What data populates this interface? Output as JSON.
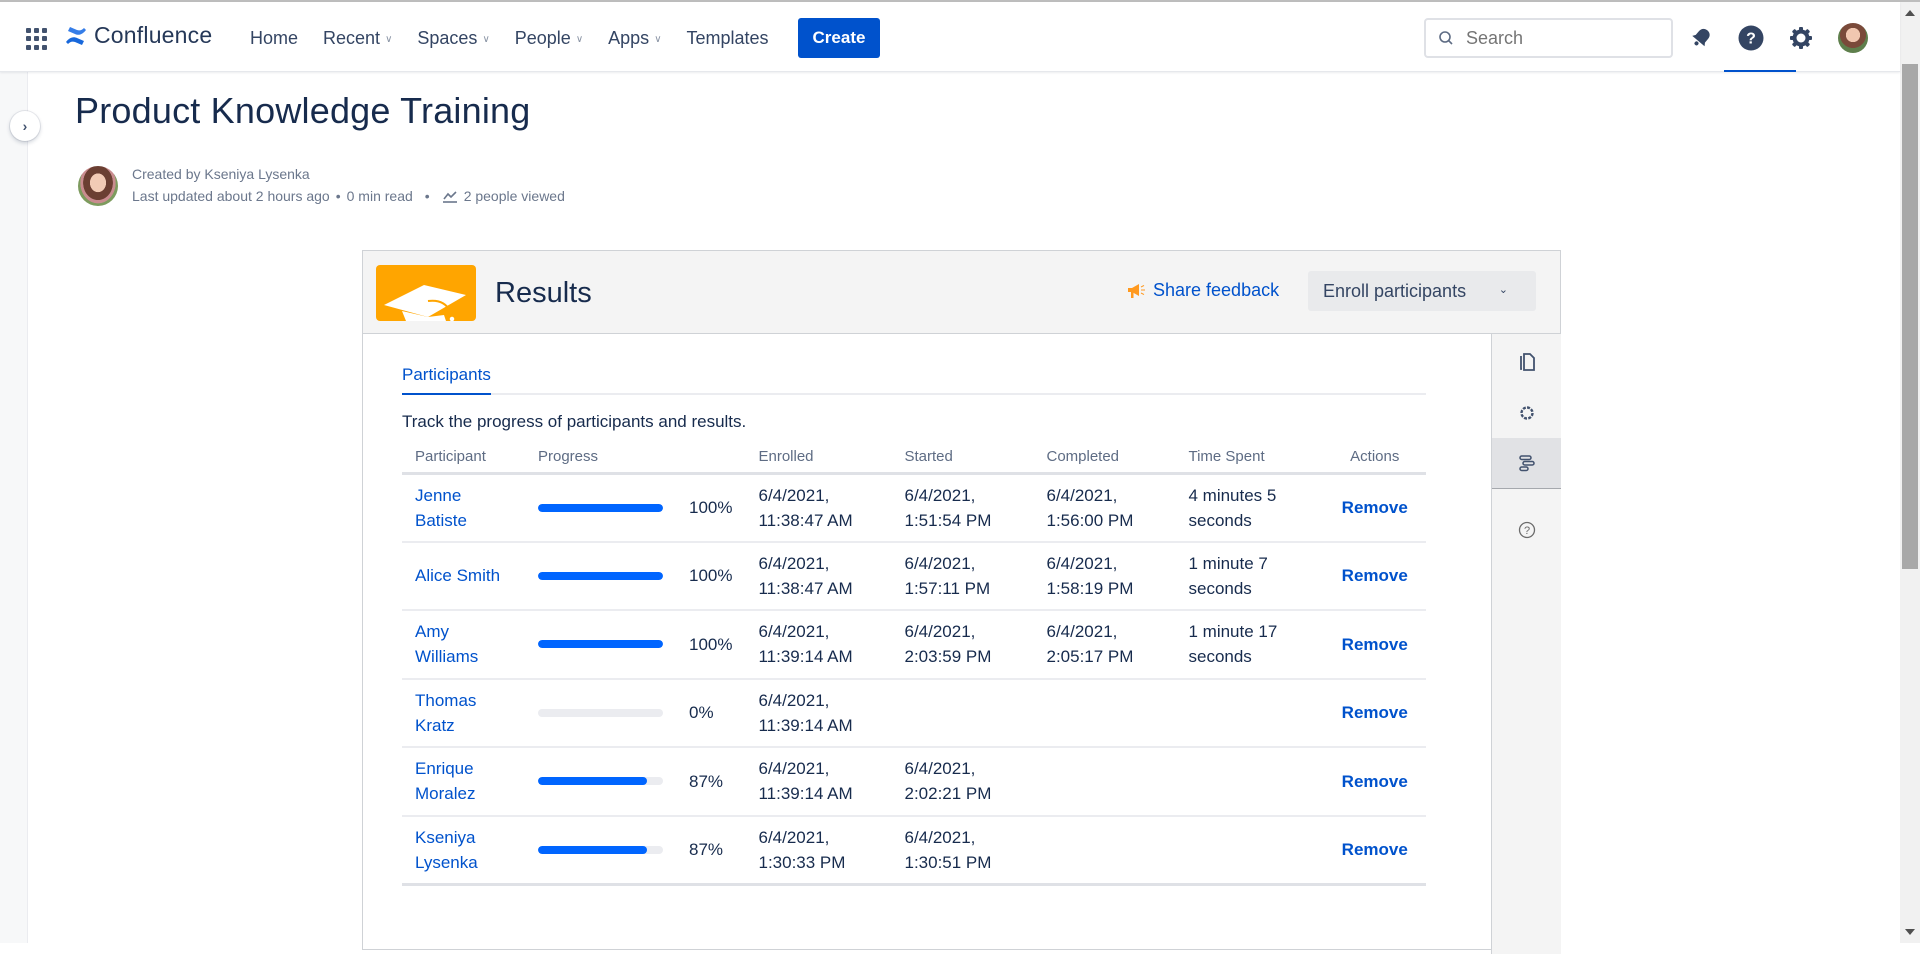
{
  "header": {
    "app_name": "Confluence",
    "nav": [
      {
        "label": "Home",
        "has_dropdown": false
      },
      {
        "label": "Recent",
        "has_dropdown": true
      },
      {
        "label": "Spaces",
        "has_dropdown": true
      },
      {
        "label": "People",
        "has_dropdown": true
      },
      {
        "label": "Apps",
        "has_dropdown": true
      },
      {
        "label": "Templates",
        "has_dropdown": false
      }
    ],
    "create_label": "Create",
    "search_placeholder": "Search",
    "icons": [
      "notifications-icon",
      "help-icon",
      "settings-icon",
      "profile-avatar"
    ],
    "brand_color": "#0052cc"
  },
  "page": {
    "title": "Product Knowledge Training",
    "created_by": "Created by Kseniya Lysenka",
    "last_updated": "Last updated about 2 hours ago",
    "read_time": "0 min read",
    "views": "2 people viewed"
  },
  "macro": {
    "title": "Results",
    "share_feedback": "Share feedback",
    "enroll_label": "Enroll participants",
    "tabs": [
      {
        "label": "Participants",
        "active": true
      }
    ],
    "description": "Track the progress of participants and results.",
    "tool_strip": [
      {
        "icon": "copy-icon",
        "active": false
      },
      {
        "icon": "settings-icon",
        "active": false
      },
      {
        "icon": "results-icon",
        "active": true
      },
      {
        "icon": "help-icon",
        "active": false
      }
    ],
    "table": {
      "columns": [
        "Participant",
        "Progress",
        "Enrolled",
        "Started",
        "Completed",
        "Time Spent",
        "Actions"
      ],
      "rows": [
        {
          "name": "Jenne Batiste",
          "progress": 100,
          "progress_label": "100%",
          "enrolled": "6/4/2021, 11:38:47 AM",
          "started": "6/4/2021, 1:51:54 PM",
          "completed": "6/4/2021, 1:56:00 PM",
          "time_spent": "4 minutes 5 seconds",
          "action": "Remove"
        },
        {
          "name": "Alice Smith",
          "progress": 100,
          "progress_label": "100%",
          "enrolled": "6/4/2021, 11:38:47 AM",
          "started": "6/4/2021, 1:57:11 PM",
          "completed": "6/4/2021, 1:58:19 PM",
          "time_spent": "1 minute 7 seconds",
          "action": "Remove"
        },
        {
          "name": "Amy Williams",
          "progress": 100,
          "progress_label": "100%",
          "enrolled": "6/4/2021, 11:39:14 AM",
          "started": "6/4/2021, 2:03:59 PM",
          "completed": "6/4/2021, 2:05:17 PM",
          "time_spent": "1 minute 17 seconds",
          "action": "Remove"
        },
        {
          "name": "Thomas Kratz",
          "progress": 0,
          "progress_label": "0%",
          "enrolled": "6/4/2021, 11:39:14 AM",
          "started": "",
          "completed": "",
          "time_spent": "",
          "action": "Remove"
        },
        {
          "name": "Enrique Moralez",
          "progress": 87,
          "progress_label": "87%",
          "enrolled": "6/4/2021, 11:39:14 AM",
          "started": "6/4/2021, 2:02:21 PM",
          "completed": "",
          "time_spent": "",
          "action": "Remove"
        },
        {
          "name": "Kseniya Lysenka",
          "progress": 87,
          "progress_label": "87%",
          "enrolled": "6/4/2021, 1:30:33 PM",
          "started": "6/4/2021, 1:30:51 PM",
          "completed": "",
          "time_spent": "",
          "action": "Remove"
        }
      ]
    },
    "colors": {
      "progress_fill": "#0065ff",
      "progress_track": "#ebecf0",
      "logo_bg": "#ffa500",
      "link": "#0052cc"
    }
  }
}
